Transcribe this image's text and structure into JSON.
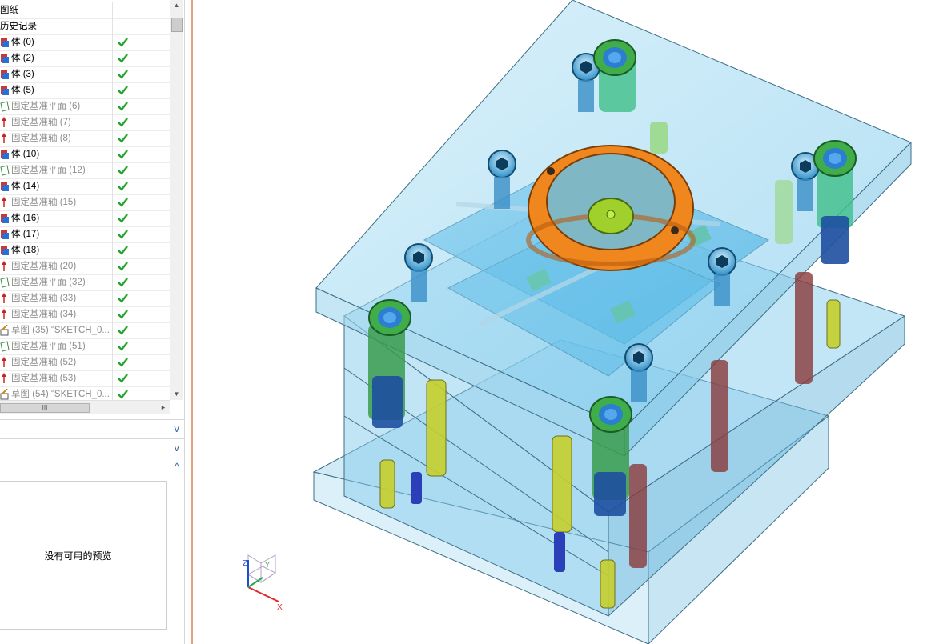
{
  "nav": {
    "rows": [
      {
        "label": "图纸",
        "kind": "header",
        "gray": false,
        "check": false
      },
      {
        "label": "历史记录",
        "kind": "header",
        "gray": false,
        "check": false
      },
      {
        "label": "体 (0)",
        "kind": "body",
        "gray": false,
        "check": true
      },
      {
        "label": "体 (2)",
        "kind": "body",
        "gray": false,
        "check": true
      },
      {
        "label": "体 (3)",
        "kind": "body",
        "gray": false,
        "check": true
      },
      {
        "label": "体 (5)",
        "kind": "body",
        "gray": false,
        "check": true
      },
      {
        "label": "固定基准平面 (6)",
        "kind": "plane",
        "gray": true,
        "check": true
      },
      {
        "label": "固定基准轴 (7)",
        "kind": "axis",
        "gray": true,
        "check": true
      },
      {
        "label": "固定基准轴 (8)",
        "kind": "axis",
        "gray": true,
        "check": true
      },
      {
        "label": "体 (10)",
        "kind": "body",
        "gray": false,
        "check": true
      },
      {
        "label": "固定基准平面 (12)",
        "kind": "plane",
        "gray": true,
        "check": true
      },
      {
        "label": "体 (14)",
        "kind": "body",
        "gray": false,
        "check": true
      },
      {
        "label": "固定基准轴 (15)",
        "kind": "axis",
        "gray": true,
        "check": true
      },
      {
        "label": "体 (16)",
        "kind": "body",
        "gray": false,
        "check": true
      },
      {
        "label": "体 (17)",
        "kind": "body",
        "gray": false,
        "check": true
      },
      {
        "label": "体 (18)",
        "kind": "body",
        "gray": false,
        "check": true
      },
      {
        "label": "固定基准轴 (20)",
        "kind": "axis",
        "gray": true,
        "check": true
      },
      {
        "label": "固定基准平面 (32)",
        "kind": "plane",
        "gray": true,
        "check": true
      },
      {
        "label": "固定基准轴 (33)",
        "kind": "axis",
        "gray": true,
        "check": true
      },
      {
        "label": "固定基准轴 (34)",
        "kind": "axis",
        "gray": true,
        "check": true
      },
      {
        "label": "草图 (35) \"SKETCH_0...",
        "kind": "sketch",
        "gray": true,
        "check": true
      },
      {
        "label": "固定基准平面 (51)",
        "kind": "plane",
        "gray": true,
        "check": true
      },
      {
        "label": "固定基准轴 (52)",
        "kind": "axis",
        "gray": true,
        "check": true
      },
      {
        "label": "固定基准轴 (53)",
        "kind": "axis",
        "gray": true,
        "check": true
      },
      {
        "label": "草图 (54) \"SKETCH_0...",
        "kind": "sketch",
        "gray": true,
        "check": true
      }
    ]
  },
  "hscroll_grip": "III",
  "sections": {
    "chevron_down": "v",
    "chevron_up": "^"
  },
  "preview": {
    "empty_text": "没有可用的预览"
  },
  "triad": {
    "x": "X",
    "y": "Y",
    "z": "Z"
  },
  "colors": {
    "divider": "#e8a07a",
    "mold_plate": "#7cc8ec",
    "locating_ring": "#f0861e",
    "guide_bush": "#3fae4a",
    "check": "#22a32a"
  }
}
